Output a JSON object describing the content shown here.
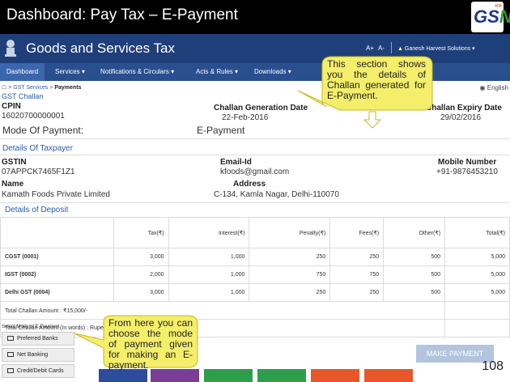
{
  "slide": {
    "title": "Dashboard: Pay Tax – E-Payment",
    "logo_text_g": "G",
    "logo_text_s": "S",
    "logo_text_n": "N",
    "logo_arrows": "«»",
    "page_number": "108"
  },
  "portal": {
    "name": "Goods and Services Tax",
    "font_increase": "A+",
    "font_decrease": "A-",
    "user_icon": "user-icon",
    "user_name": "Ganesh Harvest Solutions ▾"
  },
  "nav": {
    "items": [
      "Dashboard",
      "Services ▾",
      "Notifications & Circulars ▾",
      "Acts & Rules ▾",
      "Downloads ▾"
    ]
  },
  "breadcrumb": {
    "home_icon": "home-icon",
    "parent": "GST Services",
    "separator": ">",
    "current": "Payments"
  },
  "language": "English",
  "challan": {
    "section_title": "GST Challan",
    "cpin_label": "CPIN",
    "cpin_value": "16020700000001",
    "gen_date_label": "Challan Generation Date",
    "gen_date_value": "22-Feb-2016",
    "expiry_label": "Challan Expiry Date",
    "expiry_value": "29/02/2016",
    "mode_label": "Mode Of Payment:",
    "mode_value": "E-Payment"
  },
  "taxpayer": {
    "section_title": "Details Of Taxpayer",
    "gstin_label": "GSTIN",
    "gstin_value": "07APPCK7465F1Z1",
    "email_label": "Email-Id",
    "email_value": "kfoods@gmail.com",
    "mobile_label": "Mobile Number",
    "mobile_value": "+91-9876453210",
    "name_label": "Name",
    "name_value": "Kamath Foods Private Limited",
    "address_label": "Address",
    "address_value": "C-134, Kamla Nagar, Delhi-110070"
  },
  "deposit": {
    "section_title": "Details of Deposit",
    "columns": [
      "",
      "Tax(₹)",
      "Interest(₹)",
      "Penalty(₹)",
      "Fees(₹)",
      "Other(₹)",
      "Total(₹)"
    ],
    "rows": [
      [
        "CGST (0001)",
        "3,000",
        "1,000",
        "250",
        "250",
        "500",
        "5,000"
      ],
      [
        "IGST (0002)",
        "2,000",
        "1,000",
        "750",
        "750",
        "500",
        "5,000"
      ],
      [
        "Delhi GST (0004)",
        "3,000",
        "1,000",
        "250",
        "250",
        "500",
        "5,000"
      ]
    ],
    "total_amount": "Total Challan Amount : ₹15,000/-",
    "total_words": "Total Challan Amount (In words) : Rupees Fifteen Thousands only."
  },
  "payment": {
    "select_label": "Select Mode of E-Payment",
    "options": [
      "Preferred Banks",
      "Net Banking",
      "Credit/Debit Cards"
    ],
    "make_payment": "MAKE PAYMENT"
  },
  "callouts": {
    "top": "This section shows you the details of Challan generated for E-Payment.",
    "bottom": "From here you can choose the mode of payment given for making an E-payment."
  },
  "colors": {
    "slide_header": "#000000",
    "portal_header": "#1f3f7a",
    "nav_bar": "#2a4f8f",
    "callout_fill": "#f5ee6a",
    "callout_stroke": "#c8b820",
    "tiles": [
      "#2d4d9c",
      "#7a3d96",
      "#2e9e4a",
      "#2e9e4a",
      "#e8572a",
      "#e8572a"
    ]
  }
}
